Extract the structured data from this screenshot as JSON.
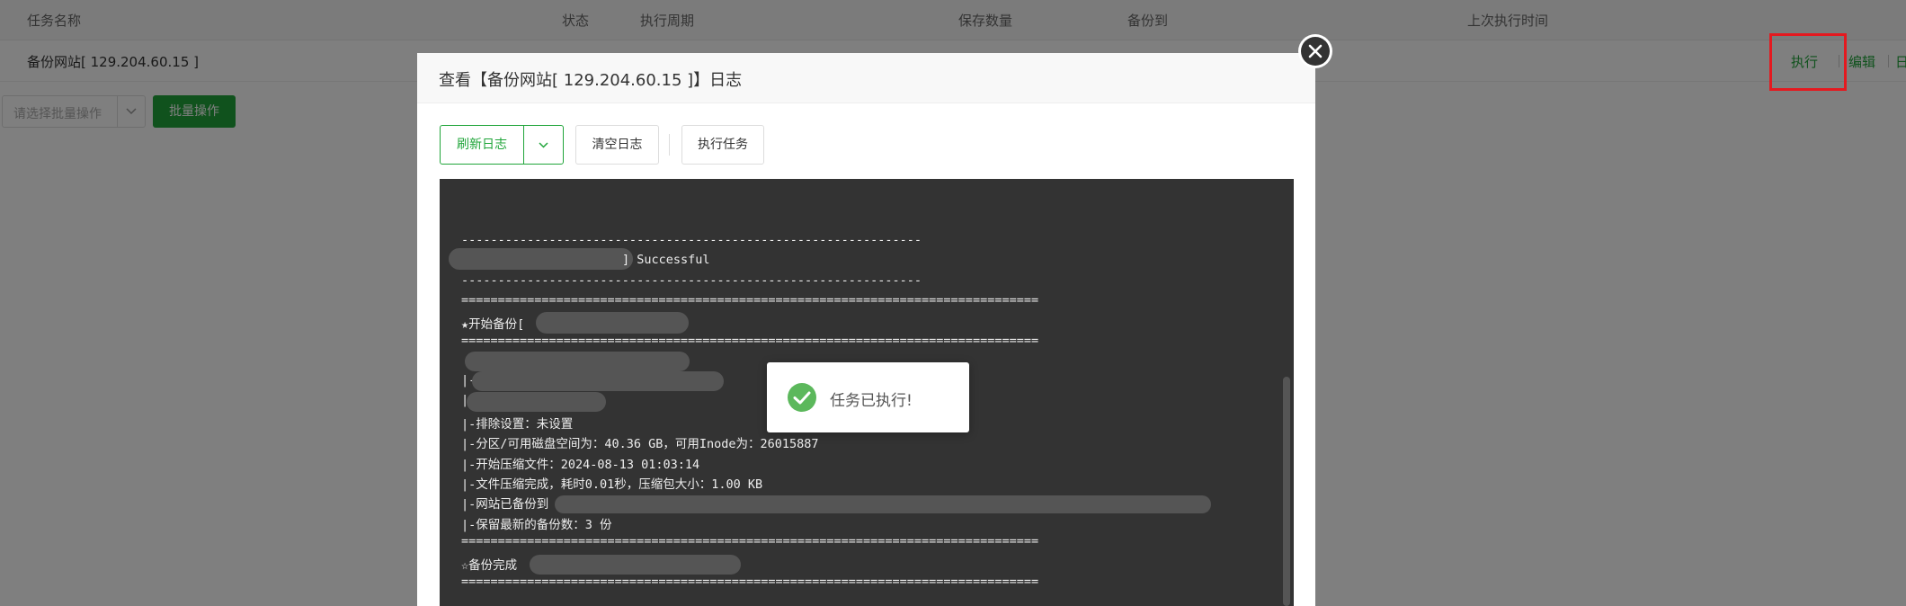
{
  "table": {
    "headers": [
      "任务名称",
      "状态",
      "执行周期",
      "保存数量",
      "备份到",
      "上次执行时间"
    ],
    "row": {
      "name": "备份网站[ 129.204.60.15 ]",
      "actions": [
        "执行",
        "编辑",
        "日"
      ]
    }
  },
  "batch": {
    "select_placeholder": "请选择批量操作",
    "button_label": "批量操作"
  },
  "modal": {
    "title": "查看【备份网站[ 129.204.60.15 ]】日志",
    "buttons": {
      "refresh": "刷新日志",
      "clear": "清空日志",
      "execute": "执行任务"
    },
    "log_lines": [
      "===============================================================================",
      "---------------------------------------------------------------",
      "] Successful",
      "---------------------------------------------------------------",
      "===============================================================================",
      "★开始备份[",
      "===============================================================================",
      "|-",
      "|-",
      "|-排除设置：未设置",
      "|-分区/可用磁盘空间为：40.36 GB，可用Inode为：26015887",
      "|-开始压缩文件：2024-08-13 01:03:14",
      "|-文件压缩完成，耗时0.01秒，压缩包大小：1.00 KB",
      "|-网站已备份到",
      "|-保留最新的备份数：3 份",
      "===============================================================================",
      "☆备份完成",
      "==============================================================================="
    ]
  },
  "toast": {
    "message": "任务已执行!"
  },
  "colors": {
    "accent": "#20a53a",
    "highlight": "#e4191f",
    "log_bg": "#333333"
  }
}
